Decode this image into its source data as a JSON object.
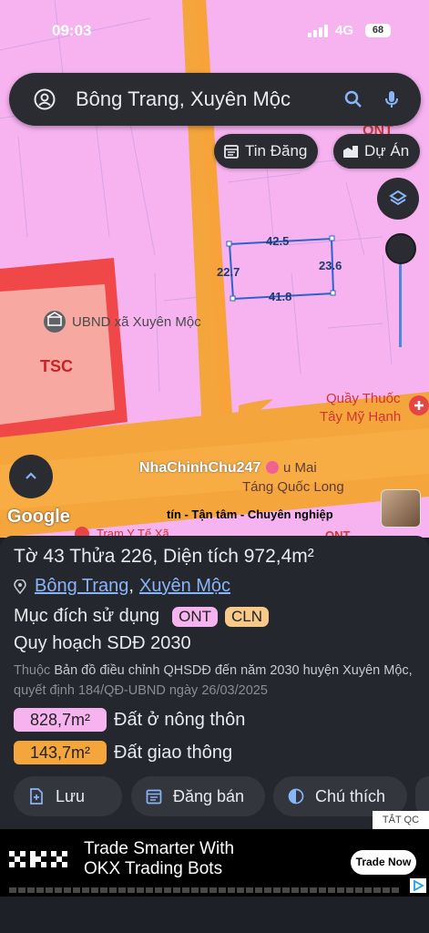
{
  "status": {
    "time": "09:03",
    "network": "4G",
    "battery": "68"
  },
  "search": {
    "query": "Bông Trang, Xuyên Mộc"
  },
  "chips": {
    "posts": "Tin Đăng",
    "projects": "Dự Án"
  },
  "map": {
    "labels": {
      "tsc": "TSC",
      "ont_top": "ONT",
      "ubnd": "UBND xã Xuyên Mộc",
      "pharmacy_1": "Quầy Thuốc",
      "pharmacy_2": "Tây Mỹ Hạnh",
      "funeral_1": "u Mai",
      "funeral_2": "Táng Quốc Long",
      "clinic": "Trạm Y Tế Xã",
      "ont_bottom": "ONT",
      "watermark": "NhaChinhChu247",
      "google": "Google",
      "banner_text": "tín - Tận tâm - Chuyên nghiệp"
    },
    "dimensions": {
      "top": "42.5",
      "left": "22.7",
      "right": "23.6",
      "bottom": "41.8"
    }
  },
  "parcel": {
    "title": "Tờ 43 Thửa 226, Diện tích 972,4m²",
    "ward": "Bông Trang",
    "district": "Xuyên Mộc",
    "purpose_label": "Mục đích sử dụng",
    "tags": [
      "ONT",
      "CLN"
    ],
    "plan_label": "Quy hoạch SDĐ 2030",
    "note_prefix": "Thuộc",
    "note_main": "Bản đồ điều chỉnh QHSDĐ đến năm 2030 huyện Xuyên Mộc,",
    "note_decision": "quyết định 184/QĐ-UBND ngày 26/03/2025",
    "areas": [
      {
        "value": "828,7m²",
        "label": "Đất ở nông thôn",
        "color": "#f6b3f0"
      },
      {
        "value": "143,7m²",
        "label": "Đất giao thông",
        "color": "#f4a53c"
      }
    ]
  },
  "actions": {
    "save": "Lưu",
    "post_sale": "Đăng bán",
    "legend": "Chú thích"
  },
  "ad": {
    "badge": "TẮT QC",
    "logo": "OKX",
    "line1": "Trade Smarter With",
    "line2": "OKX Trading Bots",
    "cta": "Trade Now"
  },
  "colors": {
    "residential": "#f6b3f0",
    "road": "#f4a53c",
    "public": "#f7a8a0",
    "accent": "#8ab4f8"
  }
}
